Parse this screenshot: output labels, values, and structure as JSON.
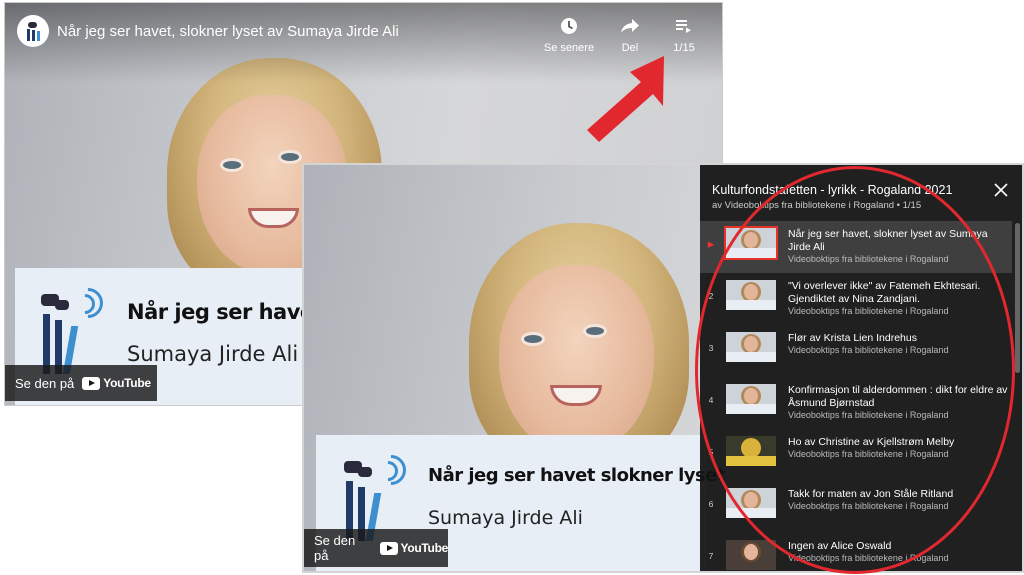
{
  "back_video": {
    "title": "Når jeg ser havet, slokner lyset av Sumaya Jirde Ali",
    "actions": [
      {
        "label": "Se senere",
        "icon": "clock-icon"
      },
      {
        "label": "Del",
        "icon": "share-icon"
      },
      {
        "label": "1/15",
        "icon": "playlist-icon"
      }
    ],
    "banner_title": "Når jeg ser havet sl",
    "banner_subtitle": "Sumaya Jirde Ali",
    "watch_on": "Se den på",
    "youtube_label": "YouTube"
  },
  "front_video": {
    "banner_title": "Når jeg ser havet slokner lyset",
    "banner_subtitle": "Sumaya Jirde Ali",
    "watch_on": "Se den på",
    "youtube_label": "YouTube"
  },
  "playlist": {
    "title": "Kulturfondstafetten - lyrikk - Rogaland 2021",
    "subtitle": "av Videoboktips fra bibliotekene i Rogaland • 1/15",
    "items": [
      {
        "index": "▶",
        "title": "Når jeg ser havet, slokner lyset av Sumaya Jirde Ali",
        "channel": "Videoboktips fra bibliotekene i Rogaland"
      },
      {
        "index": "2",
        "title": "\"Vi overlever ikke\" av Fatemeh Ekhtesari. Gjendiktet av Nina Zandjani.",
        "channel": "Videoboktips fra bibliotekene i Rogaland"
      },
      {
        "index": "3",
        "title": "Flør av Krista Lien Indrehus",
        "channel": "Videoboktips fra bibliotekene i Rogaland"
      },
      {
        "index": "4",
        "title": "Konfirmasjon til alderdommen : dikt for eldre av Åsmund Bjørnstad",
        "channel": "Videoboktips fra bibliotekene i Rogaland"
      },
      {
        "index": "5",
        "title": "Ho av Christine av Kjellstrøm Melby",
        "channel": "Videoboktips fra bibliotekene i Rogaland"
      },
      {
        "index": "6",
        "title": "Takk for maten av Jon Ståle Ritland",
        "channel": "Videoboktips fra bibliotekene i Rogaland"
      },
      {
        "index": "7",
        "title": "Ingen av Alice Oswald",
        "channel": "Videoboktips fra bibliotekene i Rogaland"
      }
    ]
  },
  "colors": {
    "annotation": "#e0282e",
    "panel_bg": "#121212",
    "logo_blue": "#223a67",
    "logo_light_blue": "#3d8fcf"
  }
}
